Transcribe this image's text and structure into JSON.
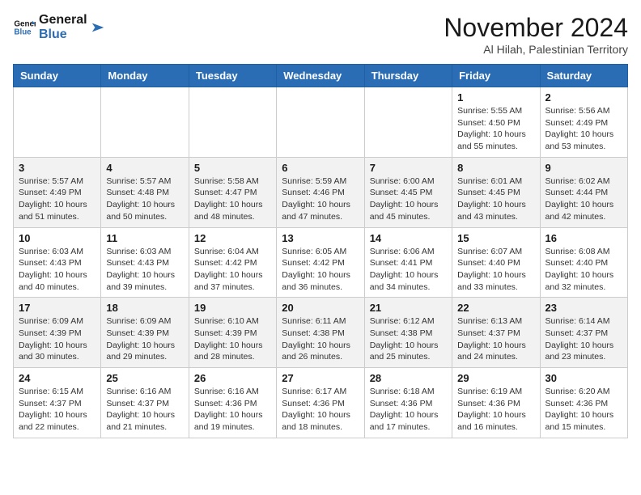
{
  "logo": {
    "text_general": "General",
    "text_blue": "Blue"
  },
  "title": "November 2024",
  "location": "Al Hilah, Palestinian Territory",
  "weekdays": [
    "Sunday",
    "Monday",
    "Tuesday",
    "Wednesday",
    "Thursday",
    "Friday",
    "Saturday"
  ],
  "rows": [
    {
      "alt": false,
      "cells": [
        {
          "day": "",
          "info": ""
        },
        {
          "day": "",
          "info": ""
        },
        {
          "day": "",
          "info": ""
        },
        {
          "day": "",
          "info": ""
        },
        {
          "day": "",
          "info": ""
        },
        {
          "day": "1",
          "info": "Sunrise: 5:55 AM\nSunset: 4:50 PM\nDaylight: 10 hours and 55 minutes."
        },
        {
          "day": "2",
          "info": "Sunrise: 5:56 AM\nSunset: 4:49 PM\nDaylight: 10 hours and 53 minutes."
        }
      ]
    },
    {
      "alt": true,
      "cells": [
        {
          "day": "3",
          "info": "Sunrise: 5:57 AM\nSunset: 4:49 PM\nDaylight: 10 hours and 51 minutes."
        },
        {
          "day": "4",
          "info": "Sunrise: 5:57 AM\nSunset: 4:48 PM\nDaylight: 10 hours and 50 minutes."
        },
        {
          "day": "5",
          "info": "Sunrise: 5:58 AM\nSunset: 4:47 PM\nDaylight: 10 hours and 48 minutes."
        },
        {
          "day": "6",
          "info": "Sunrise: 5:59 AM\nSunset: 4:46 PM\nDaylight: 10 hours and 47 minutes."
        },
        {
          "day": "7",
          "info": "Sunrise: 6:00 AM\nSunset: 4:45 PM\nDaylight: 10 hours and 45 minutes."
        },
        {
          "day": "8",
          "info": "Sunrise: 6:01 AM\nSunset: 4:45 PM\nDaylight: 10 hours and 43 minutes."
        },
        {
          "day": "9",
          "info": "Sunrise: 6:02 AM\nSunset: 4:44 PM\nDaylight: 10 hours and 42 minutes."
        }
      ]
    },
    {
      "alt": false,
      "cells": [
        {
          "day": "10",
          "info": "Sunrise: 6:03 AM\nSunset: 4:43 PM\nDaylight: 10 hours and 40 minutes."
        },
        {
          "day": "11",
          "info": "Sunrise: 6:03 AM\nSunset: 4:43 PM\nDaylight: 10 hours and 39 minutes."
        },
        {
          "day": "12",
          "info": "Sunrise: 6:04 AM\nSunset: 4:42 PM\nDaylight: 10 hours and 37 minutes."
        },
        {
          "day": "13",
          "info": "Sunrise: 6:05 AM\nSunset: 4:42 PM\nDaylight: 10 hours and 36 minutes."
        },
        {
          "day": "14",
          "info": "Sunrise: 6:06 AM\nSunset: 4:41 PM\nDaylight: 10 hours and 34 minutes."
        },
        {
          "day": "15",
          "info": "Sunrise: 6:07 AM\nSunset: 4:40 PM\nDaylight: 10 hours and 33 minutes."
        },
        {
          "day": "16",
          "info": "Sunrise: 6:08 AM\nSunset: 4:40 PM\nDaylight: 10 hours and 32 minutes."
        }
      ]
    },
    {
      "alt": true,
      "cells": [
        {
          "day": "17",
          "info": "Sunrise: 6:09 AM\nSunset: 4:39 PM\nDaylight: 10 hours and 30 minutes."
        },
        {
          "day": "18",
          "info": "Sunrise: 6:09 AM\nSunset: 4:39 PM\nDaylight: 10 hours and 29 minutes."
        },
        {
          "day": "19",
          "info": "Sunrise: 6:10 AM\nSunset: 4:39 PM\nDaylight: 10 hours and 28 minutes."
        },
        {
          "day": "20",
          "info": "Sunrise: 6:11 AM\nSunset: 4:38 PM\nDaylight: 10 hours and 26 minutes."
        },
        {
          "day": "21",
          "info": "Sunrise: 6:12 AM\nSunset: 4:38 PM\nDaylight: 10 hours and 25 minutes."
        },
        {
          "day": "22",
          "info": "Sunrise: 6:13 AM\nSunset: 4:37 PM\nDaylight: 10 hours and 24 minutes."
        },
        {
          "day": "23",
          "info": "Sunrise: 6:14 AM\nSunset: 4:37 PM\nDaylight: 10 hours and 23 minutes."
        }
      ]
    },
    {
      "alt": false,
      "cells": [
        {
          "day": "24",
          "info": "Sunrise: 6:15 AM\nSunset: 4:37 PM\nDaylight: 10 hours and 22 minutes."
        },
        {
          "day": "25",
          "info": "Sunrise: 6:16 AM\nSunset: 4:37 PM\nDaylight: 10 hours and 21 minutes."
        },
        {
          "day": "26",
          "info": "Sunrise: 6:16 AM\nSunset: 4:36 PM\nDaylight: 10 hours and 19 minutes."
        },
        {
          "day": "27",
          "info": "Sunrise: 6:17 AM\nSunset: 4:36 PM\nDaylight: 10 hours and 18 minutes."
        },
        {
          "day": "28",
          "info": "Sunrise: 6:18 AM\nSunset: 4:36 PM\nDaylight: 10 hours and 17 minutes."
        },
        {
          "day": "29",
          "info": "Sunrise: 6:19 AM\nSunset: 4:36 PM\nDaylight: 10 hours and 16 minutes."
        },
        {
          "day": "30",
          "info": "Sunrise: 6:20 AM\nSunset: 4:36 PM\nDaylight: 10 hours and 15 minutes."
        }
      ]
    }
  ]
}
